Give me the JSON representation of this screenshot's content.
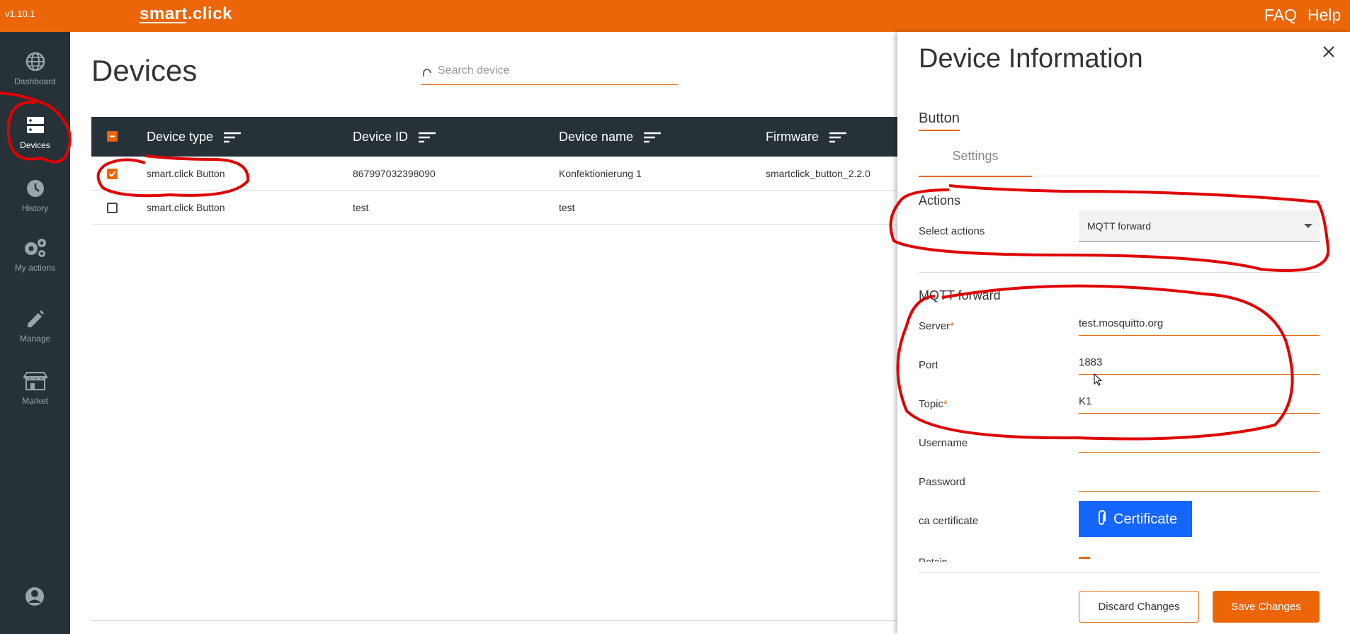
{
  "app": {
    "version": "v1.10.1",
    "logo": "smart.click",
    "brand_color": "#ec6608",
    "sidebar_color": "#263238"
  },
  "topbar": {
    "links": [
      "FAQ",
      "Help"
    ]
  },
  "sidebar": {
    "items": [
      {
        "label": "Dashboard",
        "icon": "globe-icon",
        "active": false
      },
      {
        "label": "Devices",
        "icon": "devices-icon",
        "active": true
      },
      {
        "label": "History",
        "icon": "clock-icon",
        "active": false
      },
      {
        "label": "My actions",
        "icon": "gears-icon",
        "active": false
      },
      {
        "label": "Manage",
        "icon": "pencil-icon",
        "active": false
      },
      {
        "label": "Market",
        "icon": "store-icon",
        "active": false
      }
    ],
    "account_icon": "account-icon"
  },
  "main": {
    "title": "Devices",
    "search_placeholder": "Search device",
    "columns": [
      "Device type",
      "Device ID",
      "Device name",
      "Firmware"
    ],
    "rows": [
      {
        "checked": true,
        "device_type": "smart.click Button",
        "device_id": "867997032398090",
        "device_name": "Konfektionierung 1",
        "firmware": "smartclick_button_2.2.0"
      },
      {
        "checked": false,
        "device_type": "smart.click Button",
        "device_id": "test",
        "device_name": "test",
        "firmware": ""
      }
    ]
  },
  "panel": {
    "title": "Device Information",
    "device_tab": "Button",
    "settings_tab": "Settings",
    "actions": {
      "heading": "Actions",
      "select_label": "Select actions",
      "selected": "MQTT forward"
    },
    "mqtt": {
      "heading": "MQTT forward",
      "server_label": "Server",
      "server_value": "test.mosquitto.org",
      "port_label": "Port",
      "port_value": "1883",
      "topic_label": "Topic",
      "topic_value": "K1",
      "username_label": "Username",
      "username_value": "",
      "password_label": "Password",
      "password_value": "",
      "ca_label": "ca certificate",
      "certificate_button": "Certificate",
      "retain_label": "Retain",
      "required_mark": "*"
    },
    "discard_button": "Discard Changes",
    "save_button": "Save Changes"
  }
}
